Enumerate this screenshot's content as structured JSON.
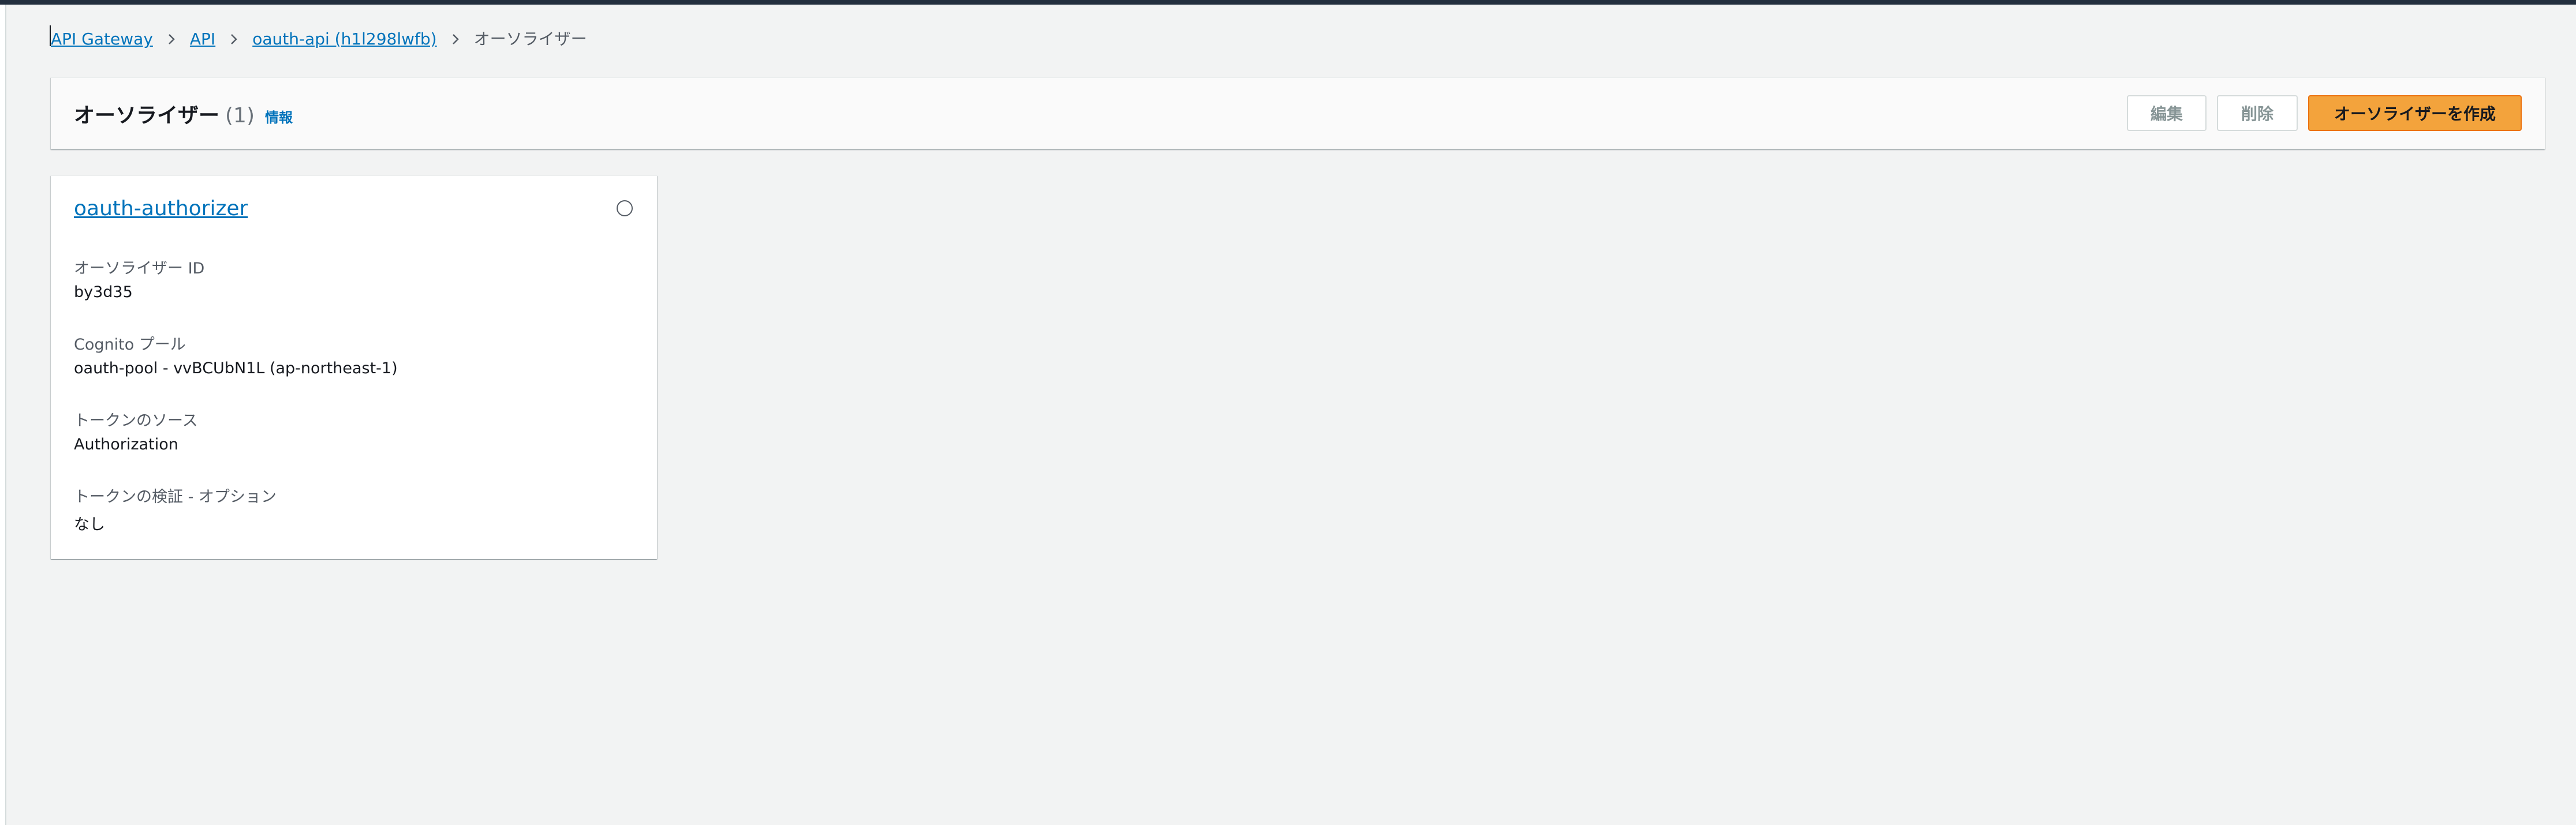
{
  "breadcrumb": {
    "items": [
      {
        "label": "API Gateway"
      },
      {
        "label": "API"
      },
      {
        "label": "oauth-api (h1l298lwfb)"
      },
      {
        "label": "オーソライザー"
      }
    ]
  },
  "header": {
    "title": "オーソライザー",
    "count": "(1)",
    "info_label": "情報",
    "edit_label": "編集",
    "delete_label": "削除",
    "create_label": "オーソライザーを作成"
  },
  "authorizer_card": {
    "name": "oauth-authorizer",
    "selected": false,
    "fields": [
      {
        "label": "オーソライザー ID",
        "value": "by3d35"
      },
      {
        "label": "Cognito プール",
        "value": "oauth-pool - vvBCUbN1L (ap-northeast-1)"
      },
      {
        "label": "トークンのソース",
        "value": "Authorization"
      },
      {
        "label": "トークンの検証 - オプション",
        "value": "なし"
      }
    ]
  },
  "colors": {
    "link": "#0073bb",
    "primary_button": "#f3a33c",
    "background": "#f2f3f3",
    "top_bar": "#232f3e"
  }
}
